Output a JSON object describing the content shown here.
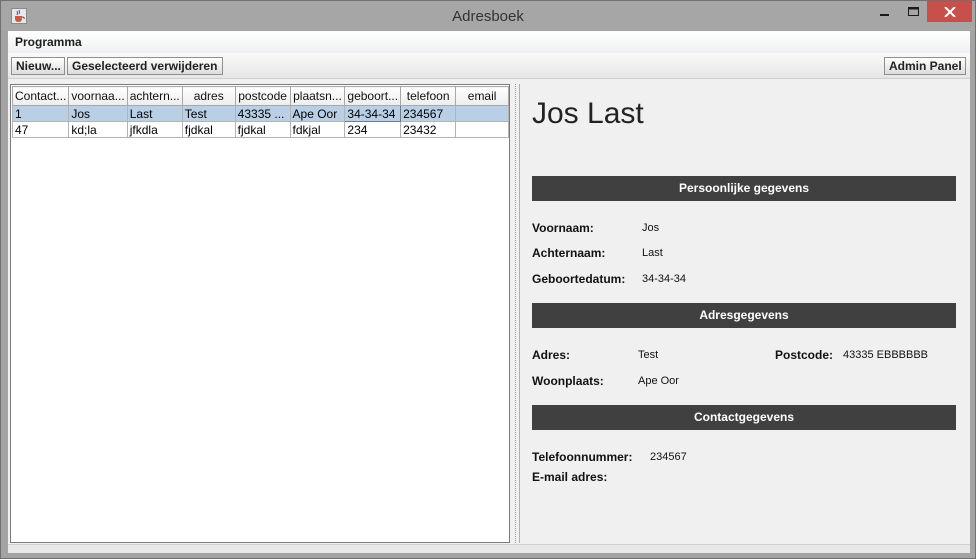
{
  "window": {
    "title": "Adresboek",
    "icons": {
      "app": "java-cup-icon",
      "minimize": "minimize-icon",
      "maximize": "maximize-icon",
      "close": "close-icon"
    },
    "close_color": "#c7504a"
  },
  "menu": {
    "items": [
      "Programma"
    ]
  },
  "toolbar": {
    "new_label": "Nieuw...",
    "delete_label": "Geselecteerd verwijderen",
    "admin_label": "Admin Panel"
  },
  "table": {
    "headers": [
      "Contact...",
      "voornaa...",
      "achtern...",
      "adres",
      "postcode",
      "plaatsn...",
      "geboort...",
      "telefoon",
      "email"
    ],
    "rows": [
      [
        "1",
        "Jos",
        "Last",
        "Test",
        "43335 ...",
        "Ape Oor",
        "34-34-34",
        "234567",
        ""
      ],
      [
        "47",
        "kd;la",
        "jfkdla",
        "fjdkal",
        "fjdkal",
        "fdkjal",
        "234",
        "23432",
        ""
      ]
    ],
    "selected_row": 0,
    "selection_color": "#b8cfe5"
  },
  "detail": {
    "name": "Jos Last",
    "section_color": "#404040",
    "sections": {
      "personal": "Persoonlijke gegevens",
      "address": "Adresgegevens",
      "contact": "Contactgegevens"
    },
    "personal": {
      "first_name_label": "Voornaam:",
      "first_name": "Jos",
      "last_name_label": "Achternaam:",
      "last_name": "Last",
      "birthdate_label": "Geboortedatum:",
      "birthdate": "34-34-34"
    },
    "address": {
      "street_label": "Adres:",
      "street": "Test",
      "postcode_label": "Postcode:",
      "postcode": "43335 EBBBBBB",
      "city_label": "Woonplaats:",
      "city": "Ape Oor"
    },
    "contact": {
      "phone_label": "Telefoonnummer:",
      "phone": "234567",
      "email_label": "E-mail adres:",
      "email": ""
    }
  }
}
